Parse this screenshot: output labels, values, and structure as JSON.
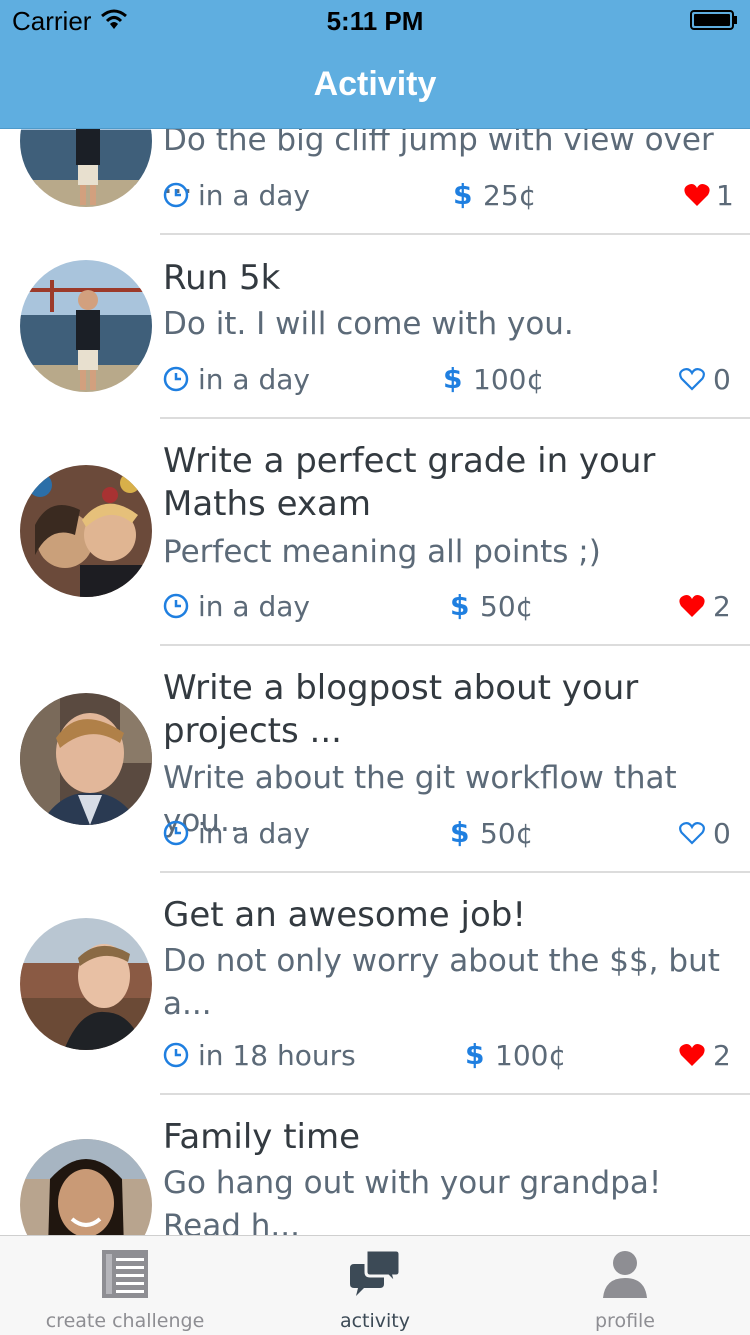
{
  "status_bar": {
    "carrier": "Carrier",
    "time": "5:11 PM"
  },
  "nav": {
    "title": "Activity"
  },
  "items": [
    {
      "title": "",
      "desc": "Do the big cliff jump with view over ...",
      "due": "in a day",
      "price": "25¢",
      "likes": "1",
      "liked": true,
      "avatar": "man-bay-bridge"
    },
    {
      "title": "Run 5k",
      "desc": "Do it. I will come with you.",
      "due": "in a day",
      "price": "100¢",
      "likes": "0",
      "liked": false,
      "avatar": "man-bay-bridge"
    },
    {
      "title": "Write a perfect grade in your Maths exam",
      "desc": "Perfect meaning all points ;)",
      "due": "in a day",
      "price": "50¢",
      "likes": "2",
      "liked": true,
      "avatar": "couple-selfie"
    },
    {
      "title": "Write a blogpost about your projects ...",
      "desc": "Write about the git workflow that you...",
      "due": "in a day",
      "price": "50¢",
      "likes": "0",
      "liked": false,
      "avatar": "man-smiling"
    },
    {
      "title": "Get an awesome job!",
      "desc": "Do not only worry about the $$, but a...",
      "due": "in 18 hours",
      "price": "100¢",
      "likes": "2",
      "liked": true,
      "avatar": "man-canyon"
    },
    {
      "title": "Family time",
      "desc": "Go hang out with your grandpa! Read h...",
      "due": "",
      "price": "",
      "likes": "",
      "liked": false,
      "avatar": "woman-smiling"
    }
  ],
  "tabs": [
    {
      "label": "create challenge",
      "icon": "list-doc-icon"
    },
    {
      "label": "activity",
      "icon": "chat-bubbles-icon"
    },
    {
      "label": "profile",
      "icon": "person-icon"
    }
  ],
  "colors": {
    "nav": "#5FAEE0",
    "accent": "#1f7fe0",
    "heart": "#ff0000"
  }
}
